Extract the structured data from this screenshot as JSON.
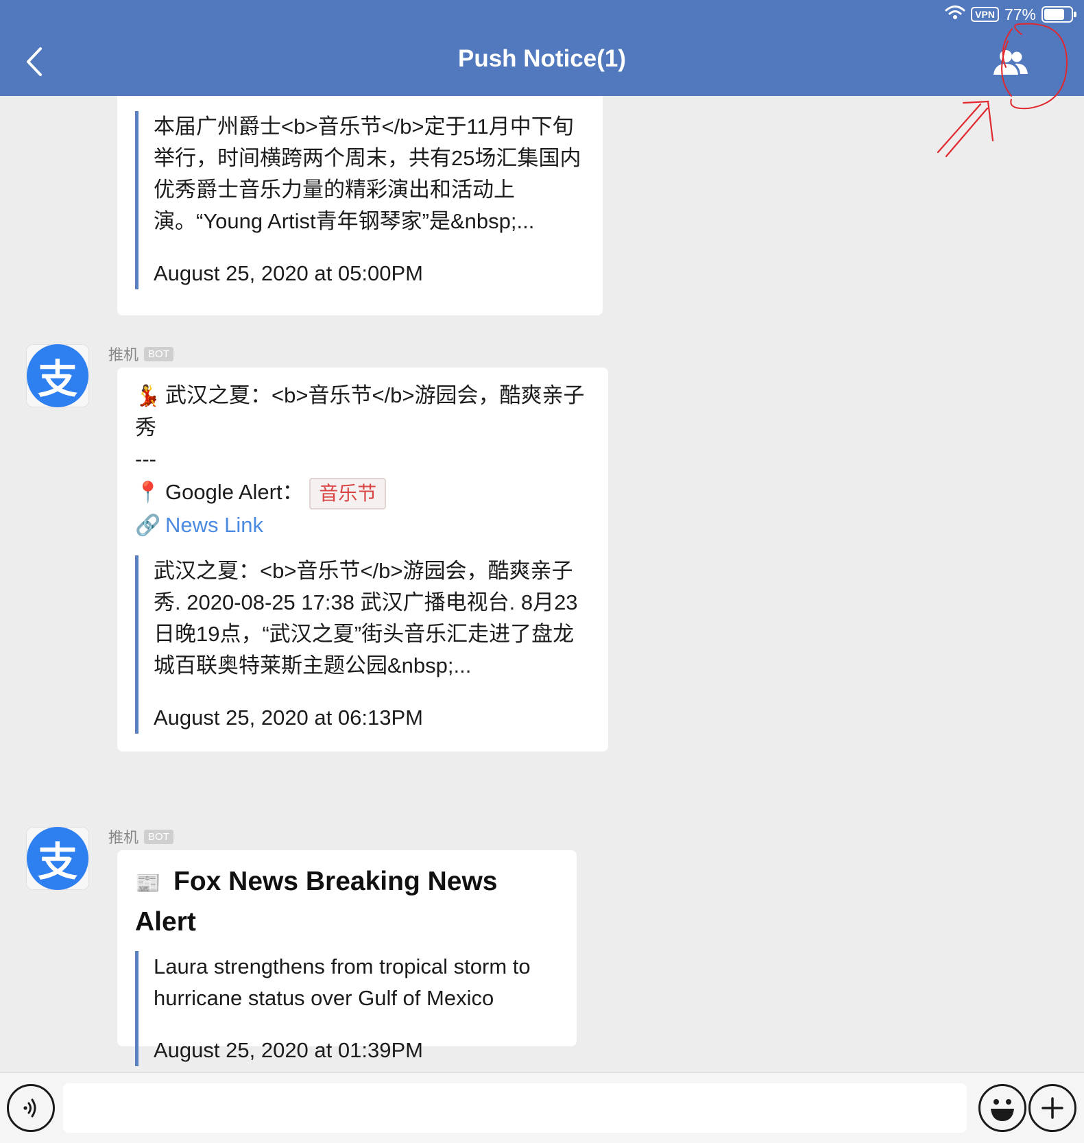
{
  "status_bar": {
    "vpn": "VPN",
    "battery": "77%",
    "battery_level": 0.77
  },
  "header": {
    "title": "Push Notice(1)"
  },
  "messages": [
    {
      "quote_text": "本届广州爵士<b>音乐节</b>定于11月中下旬举行，时间横跨两个周末，共有25场汇集国内优秀爵士音乐力量的精彩演出和活动上演。“Young Artist青年钢琴家”是&nbsp;...",
      "time": "August 25, 2020 at 05:00PM"
    },
    {
      "sender": "推机",
      "badge": "BOT",
      "avatar_glyph": "支",
      "headline_emoji": "💃",
      "headline": "武汉之夏：<b>音乐节</b>游园会，酷爽亲子秀",
      "separator": "---",
      "alert_emoji": "📍",
      "alert_label": "Google Alert：",
      "alert_keyword": "音乐节",
      "link_emoji": "🔗",
      "link_label": "News Link",
      "quote_text": "武汉之夏：<b>音乐节</b>游园会，酷爽亲子秀. 2020-08-25 17:38 武汉广播电视台. 8月23日晚19点，“武汉之夏”街头音乐汇走进了盘龙城百联奥特莱斯主题公园&nbsp;...",
      "time": "August 25, 2020 at 06:13PM"
    },
    {
      "sender": "推机",
      "badge": "BOT",
      "avatar_glyph": "支",
      "headline_emoji": "📰",
      "headline": "Fox News Breaking News Alert",
      "quote_text": "Laura strengthens from tropical storm to hurricane status over Gulf of Mexico",
      "time": "August 25, 2020 at 01:39PM"
    }
  ],
  "icons": {
    "back": "chevron-left-icon",
    "contacts": "group-icon",
    "wifi": "wifi-icon",
    "voice": "voice-icon",
    "emoji": "smiley-icon",
    "add": "plus-icon"
  },
  "colors": {
    "header": "#5279bd",
    "quote_bar": "#5b80c2",
    "link": "#4b8ae0",
    "tag_text": "#d94545",
    "avatar": "#2e7ff0",
    "annotation": "#e0282e"
  }
}
